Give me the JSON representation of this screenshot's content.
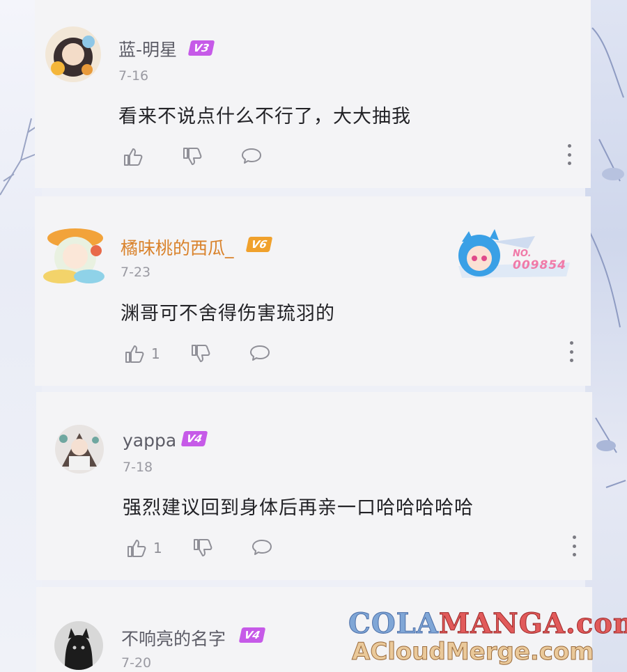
{
  "comments": [
    {
      "name": "蓝-明星",
      "level": "V3",
      "date": "7-16",
      "text": "看来不说点什么不行了，大大抽我",
      "likes": "",
      "name_color": "#5c5c66",
      "badge_color": "#c65ae8"
    },
    {
      "name": "橘味桃的西瓜_",
      "level": "V6",
      "date": "7-23",
      "text": "渊哥可不舍得伤害琉羽的",
      "likes": "1",
      "fan_badge_label": "NO.",
      "fan_badge_number": "009854",
      "name_color": "#d9822b",
      "badge_color": "#f0a12c"
    },
    {
      "name": "yappa",
      "level": "V4",
      "date": "7-18",
      "text": "强烈建议回到身体后再亲一口哈哈哈哈哈",
      "likes": "1",
      "name_color": "#5c5c66",
      "badge_color": "#c65ae8"
    },
    {
      "name": "不响亮的名字",
      "level": "V4",
      "date": "7-20",
      "name_color": "#5c5c66",
      "badge_color": "#c65ae8"
    }
  ],
  "icons": {
    "like": "thumbs-up-icon",
    "dislike": "thumbs-down-icon",
    "reply": "comment-bubble-icon",
    "more": "more-vertical-icon"
  },
  "watermark": {
    "line1_a": "COLA",
    "line1_b": "MANGA",
    "line1_c": ".com",
    "line2": "ACloudMerge.com"
  }
}
